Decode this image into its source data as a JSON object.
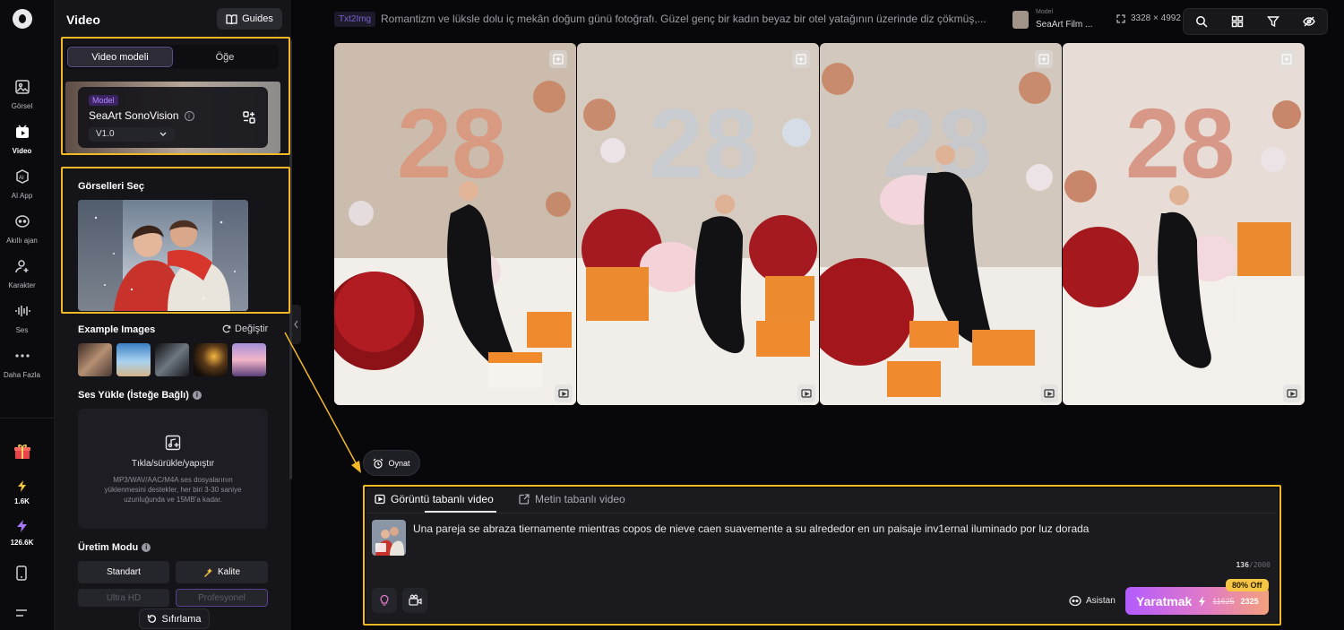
{
  "rail": {
    "items": [
      {
        "label": "Görsel"
      },
      {
        "label": "Video"
      },
      {
        "label": "AI App"
      },
      {
        "label": "Akıllı ajan"
      },
      {
        "label": "Karakter"
      },
      {
        "label": "Ses"
      },
      {
        "label": "Daha Fazla"
      }
    ],
    "credits": {
      "lightning": "1.6K",
      "stamina": "126.6K"
    }
  },
  "panel": {
    "title": "Video",
    "guides_label": "Guides",
    "tabs": [
      "Video modeli",
      "Öğe"
    ],
    "model": {
      "tag": "Model",
      "name": "SeaArt SonoVision",
      "version": "V1.0"
    },
    "select_images_title": "Görselleri Seç",
    "example_title": "Example Images",
    "change_label": "Değiştir",
    "audio_title": "Ses Yükle (İsteğe Bağlı)",
    "upload_main": "Tıkla/sürükle/yapıştır",
    "upload_hint": "MP3/WAV/AAC/M4A ses dosyalarının yüklenmesini destekler, her biri 3-30 saniye uzunluğunda ve 15MB'a kadar.",
    "mode_title": "Üretim Modu",
    "modes": [
      "Standart",
      "Kalite",
      "Ultra HD",
      "Profesyonel"
    ],
    "reset_label": "Sıfırlama"
  },
  "top": {
    "tag": "Txt2Img",
    "prompt": "Romantizm ve lüksle dolu iç mekân doğum günü fotoğrafı. Güzel genç bir kadın beyaz bir otel yatağının üzerinde diz çökmüş,...",
    "model_label": "Model",
    "model_name": "SeaArt Film ...",
    "size": "3328 × 4992"
  },
  "gallery": {
    "balloon_text": "28"
  },
  "play_label": "Oynat",
  "prompt_box": {
    "tab_image": "Görüntü tabanlı video",
    "tab_text": "Metin tabanlı video",
    "text": "Una pareja se abraza tiernamente mientras copos de nieve caen suavemente a su alrededor en un paisaje inv1ernal iluminado por luz dorada",
    "count": "136",
    "max": "/2000",
    "assistant": "Asistan",
    "create_label": "Yaratmak",
    "old_cost": "11625",
    "new_cost": "2325",
    "discount": "80% Off"
  },
  "colors": {
    "accent": "#f2b826",
    "purple": "#b35bff"
  }
}
